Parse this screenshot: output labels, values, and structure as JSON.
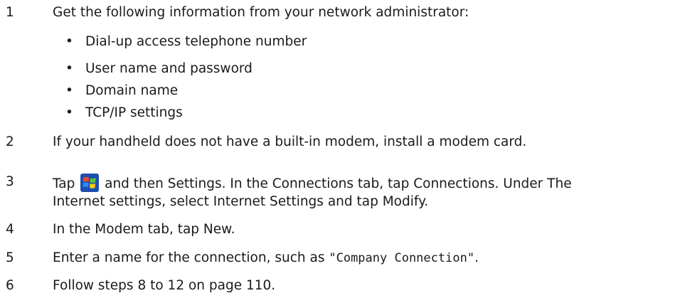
{
  "steps": [
    {
      "num": "1",
      "text": "Get the following information from your network administrator:"
    },
    {
      "num": "2",
      "text": "If your handheld does not have a built-in modem, install a modem card."
    },
    {
      "num": "3",
      "text_a": "Tap",
      "text_b": "and then Settings. In the Connections tab, tap Connections. Under The",
      "text_c": "Internet settings, select Internet Settings and tap Modify."
    },
    {
      "num": "4",
      "text": "In the Modem tab, tap New."
    },
    {
      "num": "5",
      "text_a": "Enter a name for the connection, such as ",
      "quote": "\"Company Connection\"",
      "text_b": "."
    },
    {
      "num": "6",
      "text": "Follow steps 8 to 12 on page 110."
    }
  ],
  "bullets": [
    "Dial-up access telephone number",
    "User name and password",
    "Domain name",
    "TCP/IP settings"
  ],
  "icons": {
    "start": "windows-start-icon"
  }
}
